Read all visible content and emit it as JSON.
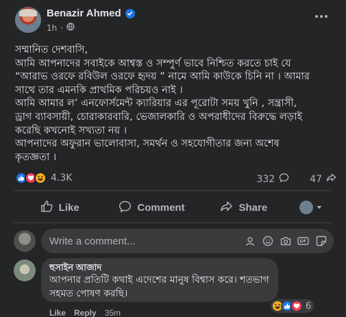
{
  "post": {
    "author": "Benazir Ahmed",
    "time": "1h",
    "dot": "·",
    "body_lines": [
      "সম্মানিত দেশবাসি,",
      "আমি আপনাদের সবাইকে আশ্বস্ত ও সম্পুর্ণ ভাবে নিশ্চিত  করতে চাই যে",
      "“আরাভ ওরফে রবিউল ওরফে হৃদয় ” নামে আমি কাউকে চিনি না । আমার",
      "সাথে তার এমনকি প্রাথমিক পরিচয়ও নাই ।",
      "আমি আমার ল’ এনফোর্সমেন্ট ক্যারিয়ার এর পূরোটা সময় খুনি , সন্ত্রাসী,",
      "ড্রাগ ব্যাবসায়ী, চোরাকারবারি, ভেজালকারি ও অপরাধীদের বিরুদ্ধে লড়াই",
      "করেছি কখনোই সখ্যতা নয় ।",
      "আপনাদের অফুরান ভালোবাসা, সমর্থন ও সহযোগীতার জন্য অশেষ",
      "কৃতজ্ঞতা ।"
    ],
    "reaction_count": "4.3K",
    "comment_count": "332",
    "share_count": "47"
  },
  "actions": {
    "like": "Like",
    "comment": "Comment",
    "share": "Share"
  },
  "composer": {
    "placeholder": "Write a comment..."
  },
  "comment": {
    "author": "হুসাইন আজাদ",
    "text_line1": "আপনার প্রতিটি কথাই এদেশের মানুষ বিশ্বাস করে। শতভাগ",
    "text_line2": "সহমত পোষণ করছি।",
    "reaction_count": "6",
    "like_label": "Like",
    "reply_label": "Reply",
    "time": "35m"
  },
  "colors": {
    "background": "#242526",
    "bubble": "#3a3b3c",
    "text": "#e4e6eb",
    "muted": "#b0b3b8",
    "accent": "#1b74e4"
  }
}
